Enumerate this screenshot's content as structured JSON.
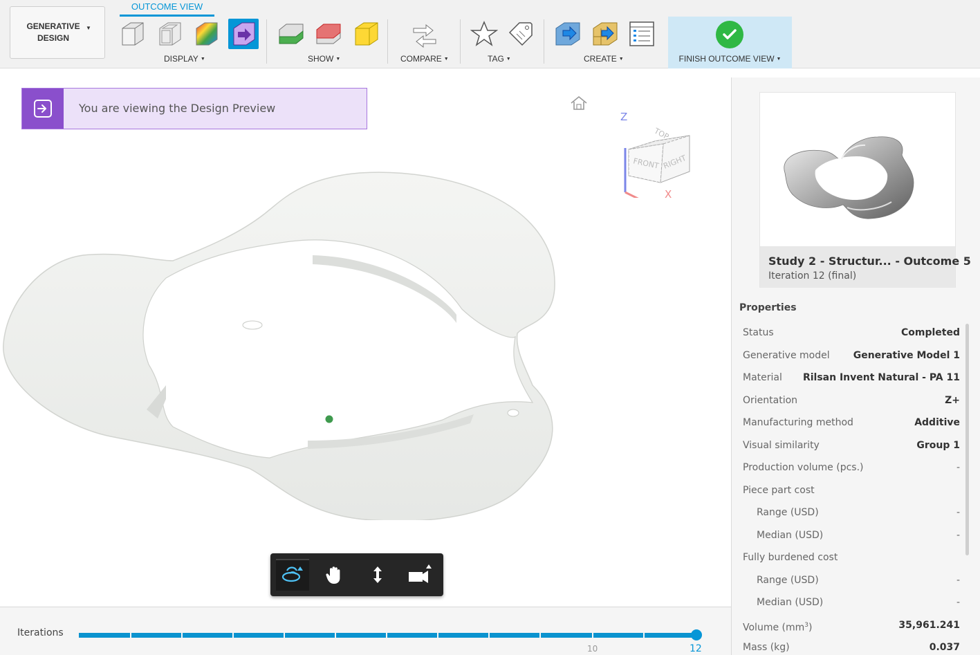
{
  "toolbar": {
    "workspace_line1": "GENERATIVE",
    "workspace_line2": "DESIGN",
    "active_tab": "OUTCOME VIEW",
    "groups": {
      "display": "DISPLAY",
      "show": "SHOW",
      "compare": "COMPARE",
      "tag": "TAG",
      "create": "CREATE",
      "finish": "FINISH OUTCOME VIEW"
    },
    "accent_color": "#0696d7",
    "icons": [
      "shaded-cube-icon",
      "wireframe-cube-icon",
      "stress-map-icon",
      "preview-mode-icon",
      "show-green-icon",
      "show-red-icon",
      "show-yellow-icon",
      "compare-arrows-icon",
      "star-icon",
      "tag-icon",
      "export-design-icon",
      "create-mesh-icon",
      "create-drawing-icon",
      "finish-check-icon"
    ]
  },
  "viewport": {
    "banner_text": "You are viewing the Design Preview",
    "viewcube": {
      "top": "TOP",
      "front": "FRONT",
      "right": "RIGHT",
      "axis_z": "Z",
      "axis_x": "X"
    },
    "nav_icons": [
      "orbit-icon",
      "pan-icon",
      "zoom-icon",
      "camera-icon"
    ]
  },
  "iterations": {
    "label": "Iterations",
    "tick_mid": "10",
    "tick_end": "12",
    "current": 12,
    "max": 12
  },
  "panel": {
    "outcome_name": "Study 2 - Structur... - Outcome 5",
    "outcome_iteration": "Iteration 12 (final)",
    "properties_title": "Properties",
    "properties": [
      {
        "key": "Status",
        "value": "Completed"
      },
      {
        "key": "Generative model",
        "value": "Generative Model 1"
      },
      {
        "key": "Material",
        "value": "Rilsan Invent Natural - PA 11"
      },
      {
        "key": "Orientation",
        "value": "Z+"
      },
      {
        "key": "Manufacturing method",
        "value": "Additive"
      },
      {
        "key": "Visual similarity",
        "value": "Group 1"
      },
      {
        "key": "Production volume (pcs.)",
        "value": "-"
      },
      {
        "key": "Piece part cost",
        "value": ""
      },
      {
        "key": "Range (USD)",
        "value": "-"
      },
      {
        "key": "Median (USD)",
        "value": "-"
      },
      {
        "key": "Fully burdened cost",
        "value": ""
      },
      {
        "key": "Range (USD)",
        "value": "-"
      },
      {
        "key": "Median (USD)",
        "value": "-"
      },
      {
        "key": "Volume (mm3)",
        "value": "35,961.241"
      },
      {
        "key": "Mass (kg)",
        "value": "0.037"
      }
    ]
  }
}
